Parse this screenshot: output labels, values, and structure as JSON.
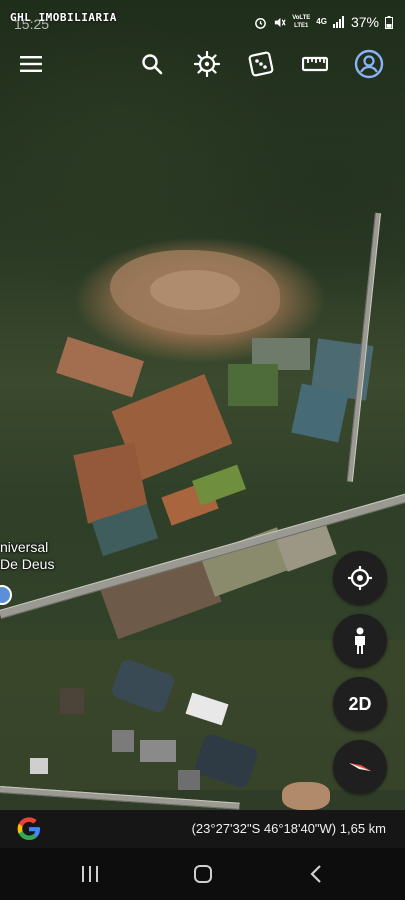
{
  "status": {
    "time": "15:25",
    "network_top": "4G",
    "network_left": "VoLTE",
    "network_bottom": "LTE1",
    "battery": "37%"
  },
  "watermark": "GHL IMOBILIARIA",
  "toolbar": {
    "menu_icon": "menu-icon",
    "search_icon": "search-icon",
    "voyager_icon": "ship-wheel-icon",
    "feeling_lucky_icon": "dice-icon",
    "measure_icon": "ruler-icon",
    "account_icon": "account-circle-icon"
  },
  "map": {
    "place_label_line1": "niversal",
    "place_label_line2": "De Deus"
  },
  "controls": {
    "my_location_icon": "crosshair-icon",
    "street_view_icon": "pegman-icon",
    "view_mode_label": "2D",
    "compass_icon": "compass-icon"
  },
  "info_bar": {
    "logo_icon": "google-g-icon",
    "coordinates": "(23°27'32\"S 46°18'40\"W) 1,65 km"
  },
  "nav": {
    "recents_icon": "recents-icon",
    "home_icon": "home-icon",
    "back_icon": "back-icon"
  },
  "colors": {
    "accent_blue": "#8ab4f8",
    "fab_background": "#1f1f1f",
    "info_bar_background": "#161616",
    "compass_red": "#e8453c"
  }
}
